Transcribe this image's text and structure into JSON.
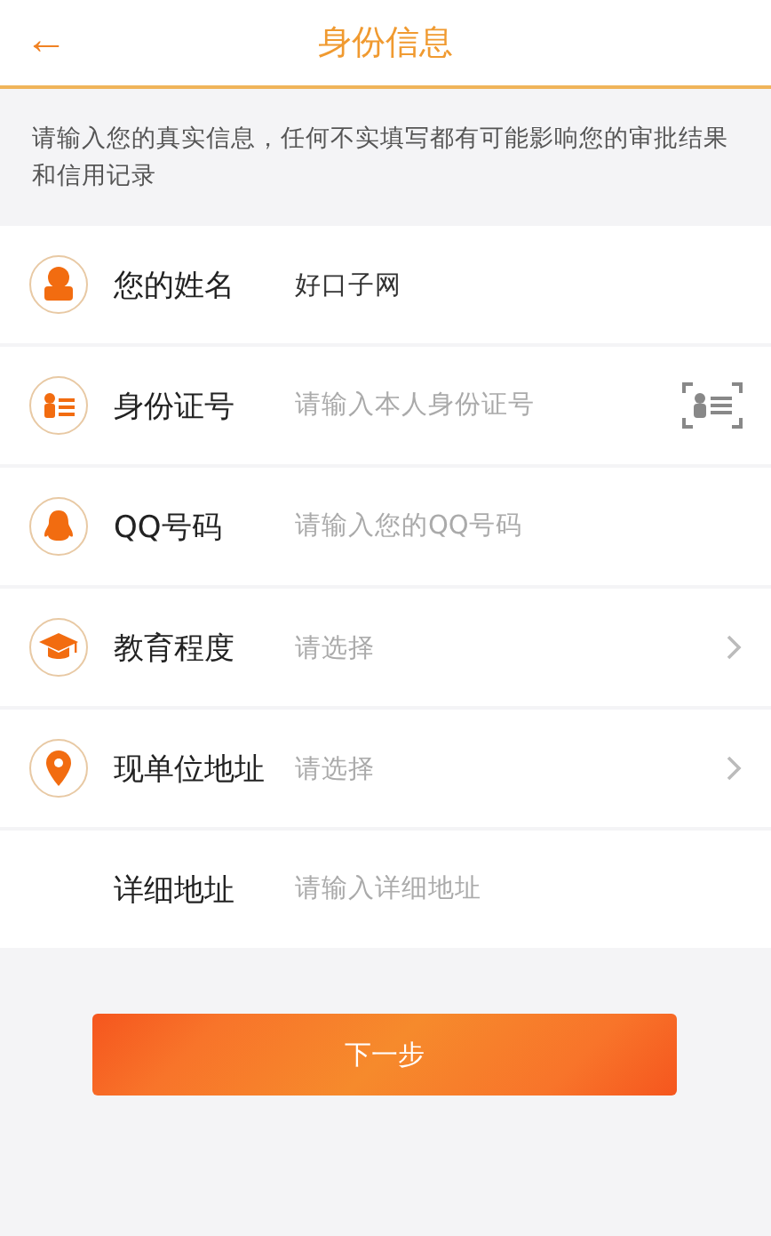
{
  "header": {
    "back": "←",
    "title": "身份信息"
  },
  "notice": "请输入您的真实信息，任何不实填写都有可能影响您的审批结果和信用记录",
  "rows": [
    {
      "kind": "input",
      "label": "您的姓名",
      "value": "好口子网"
    },
    {
      "kind": "id-input",
      "label": "身份证号",
      "placeholder": "请输入本人身份证号"
    },
    {
      "kind": "input",
      "label": "QQ号码",
      "placeholder": "请输入您的QQ号码"
    },
    {
      "kind": "select",
      "label": "教育程度",
      "placeholder": "请选择"
    },
    {
      "kind": "select",
      "label": "现单位地址",
      "placeholder": "请选择"
    },
    {
      "kind": "input",
      "label": "详细地址",
      "placeholder": "请输入详细地址"
    }
  ],
  "next_button": "下一步"
}
